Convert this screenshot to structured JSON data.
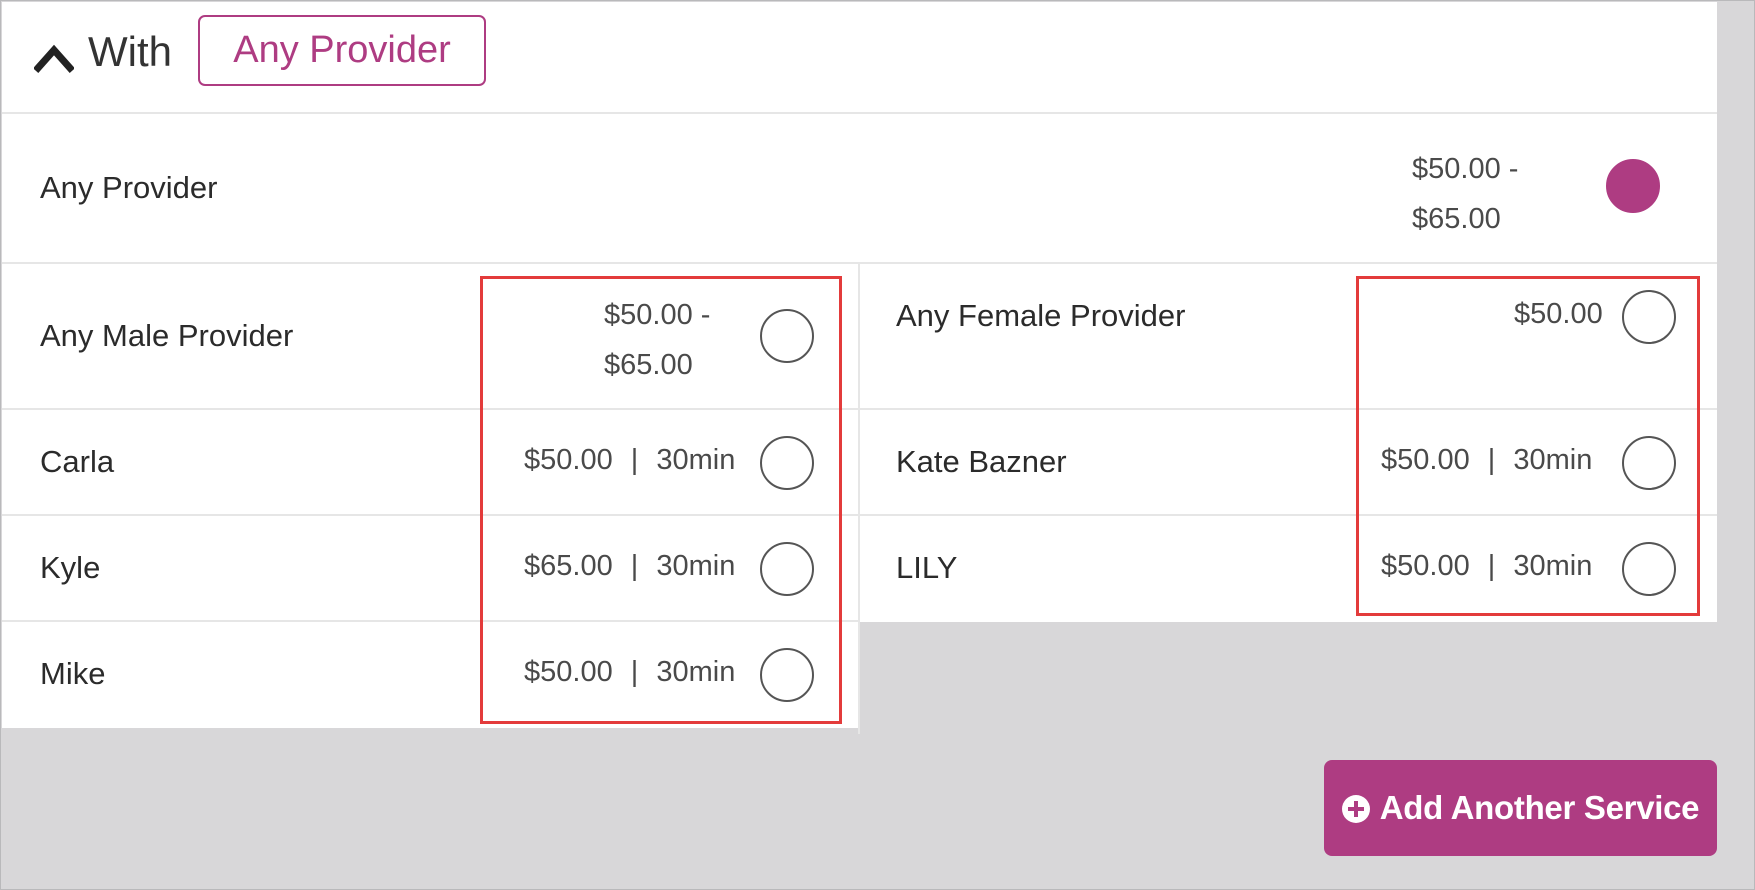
{
  "header": {
    "with_label": "With",
    "selected_provider": "Any Provider"
  },
  "any_provider": {
    "name": "Any Provider",
    "price_line1": "$50.00 -",
    "price_line2": "$65.00",
    "selected": true
  },
  "left_column": [
    {
      "name": "Any Male Provider",
      "price_line1": "$50.00 -",
      "price_line2": "$65.00"
    },
    {
      "name": "Carla",
      "price": "$50.00",
      "sep": "|",
      "duration": "30min"
    },
    {
      "name": "Kyle",
      "price": "$65.00",
      "sep": "|",
      "duration": "30min"
    },
    {
      "name": "Mike",
      "price": "$50.00",
      "sep": "|",
      "duration": "30min"
    }
  ],
  "right_column": [
    {
      "name": "Any Female Provider",
      "price": "$50.00"
    },
    {
      "name": "Kate Bazner",
      "price": "$50.00",
      "sep": "|",
      "duration": "30min"
    },
    {
      "name": "LILY",
      "price": "$50.00",
      "sep": "|",
      "duration": "30min"
    }
  ],
  "add_button": {
    "label": "Add Another Service"
  },
  "colors": {
    "accent": "#ae3c82",
    "highlight": "#e33b3b",
    "background": "#d8d7d9"
  }
}
